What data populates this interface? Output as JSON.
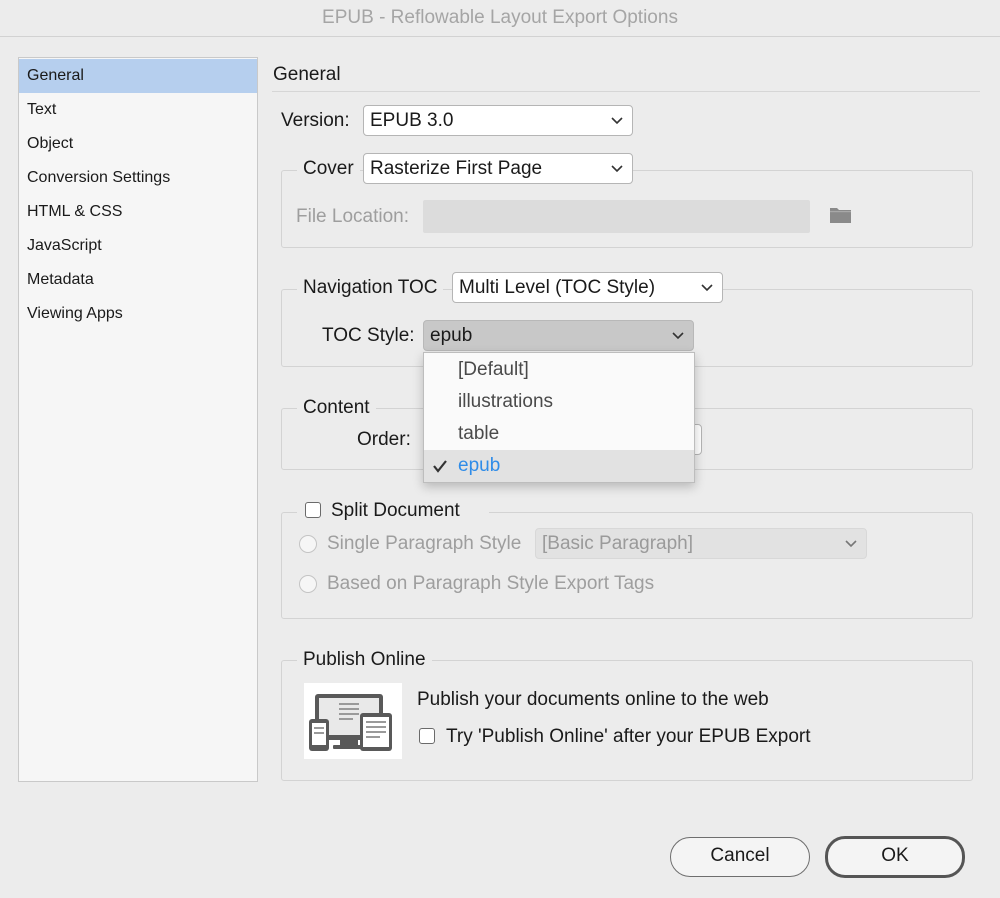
{
  "window": {
    "title": "EPUB - Reflowable Layout Export Options"
  },
  "sidebar": {
    "items": [
      {
        "label": "General",
        "selected": true
      },
      {
        "label": "Text",
        "selected": false
      },
      {
        "label": "Object",
        "selected": false
      },
      {
        "label": "Conversion Settings",
        "selected": false
      },
      {
        "label": "HTML & CSS",
        "selected": false
      },
      {
        "label": "JavaScript",
        "selected": false
      },
      {
        "label": "Metadata",
        "selected": false
      },
      {
        "label": "Viewing Apps",
        "selected": false
      }
    ]
  },
  "main": {
    "section_title": "General",
    "version": {
      "label": "Version:",
      "value": "EPUB 3.0"
    },
    "cover": {
      "label": "Cover",
      "value": "Rasterize First Page",
      "file_location_label": "File Location:",
      "file_location_value": ""
    },
    "navigation": {
      "label": "Navigation TOC",
      "value": "Multi Level (TOC Style)",
      "toc_style_label": "TOC Style:",
      "toc_style_value": "epub"
    },
    "toc_dropdown": {
      "options": [
        {
          "label": "[Default]",
          "checked": false
        },
        {
          "label": "illustrations",
          "checked": false
        },
        {
          "label": "table",
          "checked": false
        },
        {
          "label": "epub",
          "checked": true
        }
      ]
    },
    "content": {
      "label": "Content",
      "order_label": "Order:"
    },
    "split": {
      "label": "Split Document",
      "checked": false,
      "single_paragraph_label": "Single Paragraph Style",
      "single_paragraph_value": "[Basic Paragraph]",
      "based_on_label": "Based on Paragraph Style Export Tags"
    },
    "publish": {
      "label": "Publish Online",
      "description": "Publish your documents online to the web",
      "try_label": "Try 'Publish Online' after your EPUB Export",
      "try_checked": false
    }
  },
  "footer": {
    "cancel_label": "Cancel",
    "ok_label": "OK"
  },
  "colors": {
    "selection": "#b6cfee",
    "accent": "#2f8ce8",
    "background": "#ececec"
  },
  "icons": {
    "folder": "folder-icon",
    "chevron": "chevron-down-icon",
    "check": "checkmark-icon",
    "publish": "devices-icon"
  }
}
